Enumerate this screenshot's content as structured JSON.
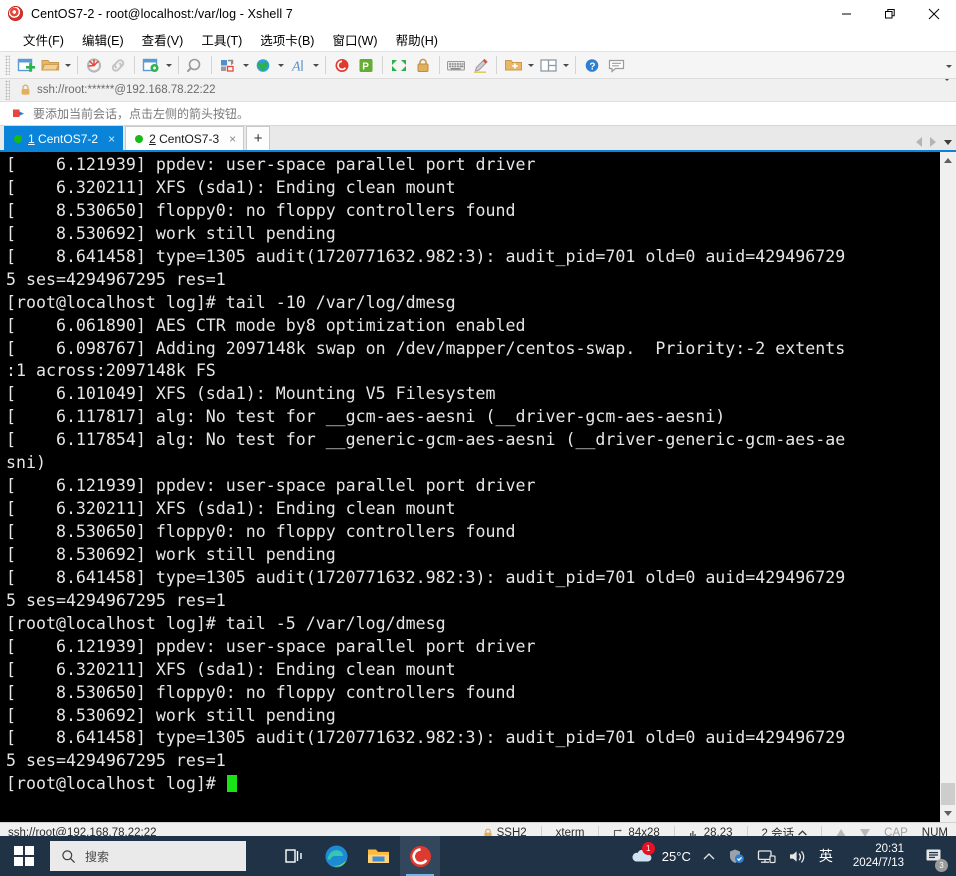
{
  "window": {
    "title": "CentOS7-2 - root@localhost:/var/log - Xshell 7",
    "icon": "xshell-spiral-icon",
    "controls": {
      "minimize": "minimize-icon",
      "restore": "restore-icon",
      "close": "close-icon"
    }
  },
  "menu": {
    "items": [
      {
        "label": "文件(F)",
        "name": "menu-file"
      },
      {
        "label": "编辑(E)",
        "name": "menu-edit"
      },
      {
        "label": "查看(V)",
        "name": "menu-view"
      },
      {
        "label": "工具(T)",
        "name": "menu-tools"
      },
      {
        "label": "选项卡(B)",
        "name": "menu-tabs"
      },
      {
        "label": "窗口(W)",
        "name": "menu-window"
      },
      {
        "label": "帮助(H)",
        "name": "menu-help"
      }
    ]
  },
  "toolbar": {
    "buttons": [
      "new-session-icon",
      "open-folder-icon",
      "disconnect-icon",
      "link-icon",
      "session-properties-icon",
      "find-icon",
      "transfer-icon",
      "globe-icon",
      "font-icon",
      "xshell-icon",
      "xftp-icon",
      "fullscreen-icon",
      "lock-icon",
      "keyboard-icon",
      "highlight-icon",
      "add-folder-icon",
      "layout-icon",
      "help-icon",
      "feedback-icon"
    ]
  },
  "address": {
    "lock_icon": "lock-icon",
    "value": "ssh://root:******@192.168.78.22:22",
    "dropdown_icon": "chevron-down-icon"
  },
  "hint": {
    "icon": "arrow-flag-icon",
    "text": "要添加当前会话，点击左侧的箭头按钮。"
  },
  "tabs": {
    "items": [
      {
        "index": "1",
        "label": "CentOS7-2",
        "active": true,
        "close": "×",
        "status": "connected"
      },
      {
        "index": "2",
        "label": "CentOS7-3",
        "active": false,
        "close": "×",
        "status": "connected"
      }
    ],
    "add_label": "+",
    "nav": {
      "prev": "prev-tab-icon",
      "next": "next-tab-icon",
      "list": "tab-list-icon"
    }
  },
  "terminal": {
    "lines": [
      "[    6.121939] ppdev: user-space parallel port driver",
      "[    6.320211] XFS (sda1): Ending clean mount",
      "[    8.530650] floppy0: no floppy controllers found",
      "[    8.530692] work still pending",
      "[    8.641458] type=1305 audit(1720771632.982:3): audit_pid=701 old=0 auid=429496729",
      "5 ses=4294967295 res=1",
      "[root@localhost log]# tail -10 /var/log/dmesg",
      "[    6.061890] AES CTR mode by8 optimization enabled",
      "[    6.098767] Adding 2097148k swap on /dev/mapper/centos-swap.  Priority:-2 extents",
      ":1 across:2097148k FS",
      "[    6.101049] XFS (sda1): Mounting V5 Filesystem",
      "[    6.117817] alg: No test for __gcm-aes-aesni (__driver-gcm-aes-aesni)",
      "[    6.117854] alg: No test for __generic-gcm-aes-aesni (__driver-generic-gcm-aes-ae",
      "sni)",
      "[    6.121939] ppdev: user-space parallel port driver",
      "[    6.320211] XFS (sda1): Ending clean mount",
      "[    8.530650] floppy0: no floppy controllers found",
      "[    8.530692] work still pending",
      "[    8.641458] type=1305 audit(1720771632.982:3): audit_pid=701 old=0 auid=429496729",
      "5 ses=4294967295 res=1",
      "[root@localhost log]# tail -5 /var/log/dmesg",
      "[    6.121939] ppdev: user-space parallel port driver",
      "[    6.320211] XFS (sda1): Ending clean mount",
      "[    8.530650] floppy0: no floppy controllers found",
      "[    8.530692] work still pending",
      "[    8.641458] type=1305 audit(1720771632.982:3): audit_pid=701 old=0 auid=429496729",
      "5 ses=4294967295 res=1"
    ],
    "prompt": "[root@localhost log]# ",
    "cursor": "block-cursor",
    "fg_color": "#e6e6e6",
    "bg_color": "#000000",
    "cursor_color": "#19e219"
  },
  "statusbar": {
    "connection": "ssh://root@192.168.78.22:22",
    "protocol": "SSH2",
    "protocol_icon": "lock-icon",
    "term_type": "xterm",
    "size_icon": "size-icon",
    "size": "84x28",
    "pos_icon": "position-icon",
    "position": "28,23",
    "sessions": "2 会话",
    "sessions_caret": "chevron-up-icon",
    "upload_icon": "arrow-up-icon",
    "download_icon": "arrow-down-icon",
    "caps": "CAP",
    "num": "NUM"
  },
  "taskbar": {
    "start": "windows-start-icon",
    "search_placeholder": "搜索",
    "search_icon": "search-icon",
    "items": [
      {
        "name": "task-view-icon",
        "label": "task-view"
      },
      {
        "name": "edge-icon",
        "label": "Microsoft Edge"
      },
      {
        "name": "file-explorer-icon",
        "label": "File Explorer"
      },
      {
        "name": "xshell-taskbar-icon",
        "label": "Xshell 7",
        "active": true
      }
    ],
    "tray": {
      "weather_icon": "weather-cloud-icon",
      "weather_badge": "1",
      "weather_temp": "25°C",
      "overflow_icon": "chevron-up-icon",
      "shield_icon": "security-icon",
      "network_icon": "network-icon",
      "volume_icon": "volume-icon",
      "ime": "英",
      "time": "20:31",
      "date": "2024/7/13",
      "notification_icon": "notification-icon",
      "notification_badge": "3"
    }
  },
  "colors": {
    "accent": "#0a84d8",
    "taskbar_bg": "#1f3246",
    "terminal_bg": "#000000",
    "connected_dot": "#17bb17"
  }
}
